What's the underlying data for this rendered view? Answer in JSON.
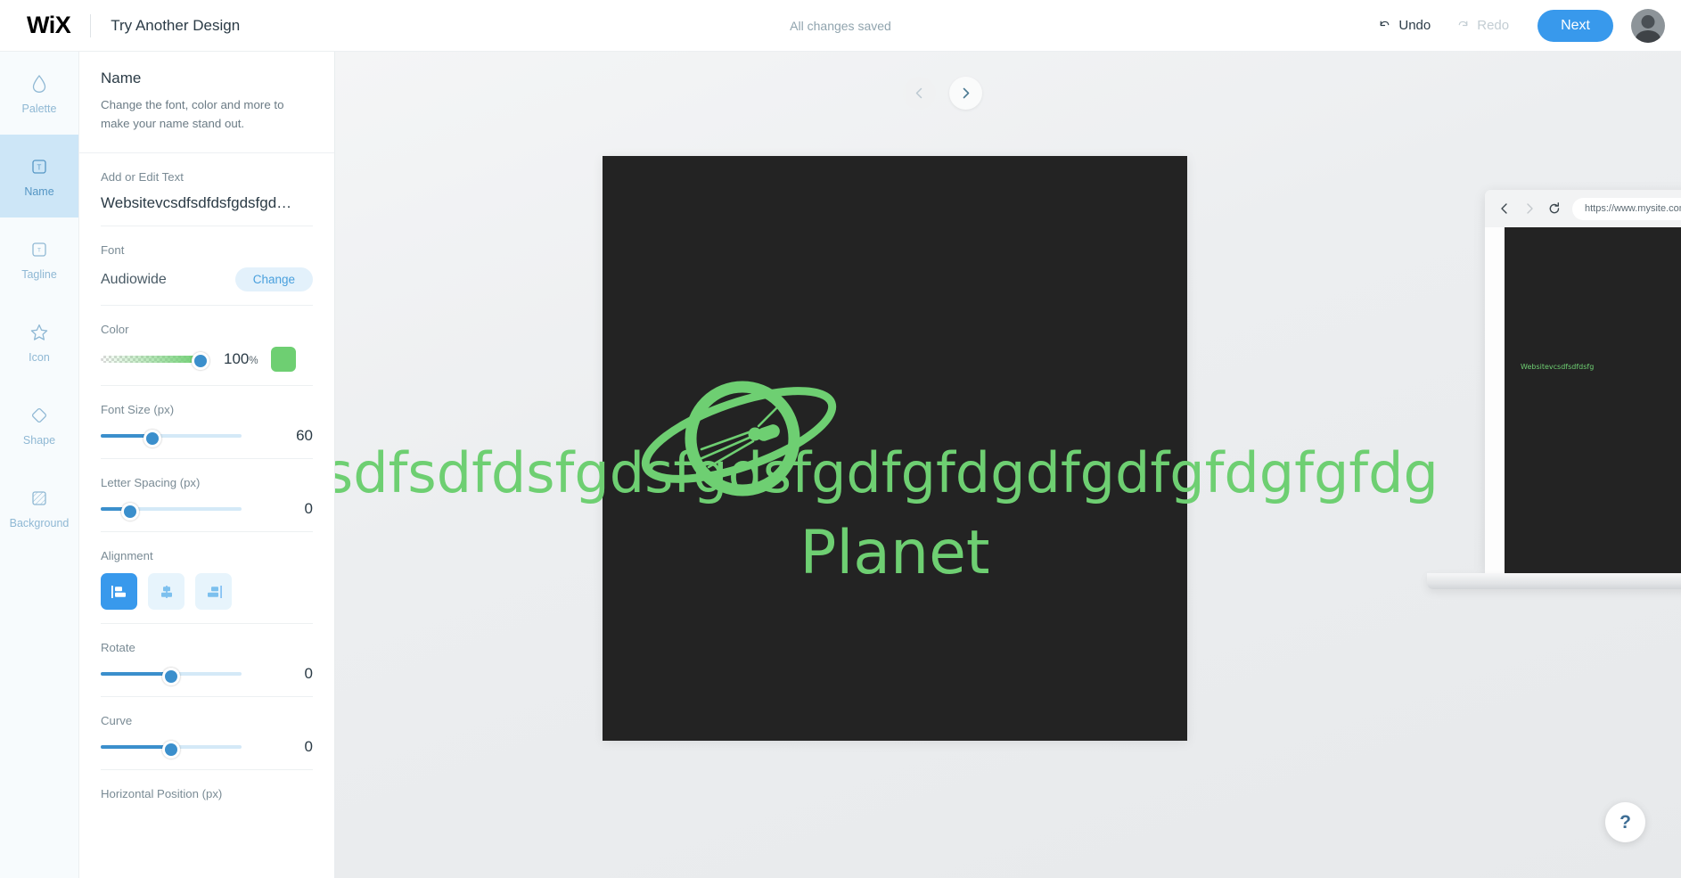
{
  "topbar": {
    "brand": "WiX",
    "try_another_design": "Try Another Design",
    "save_status": "All changes saved",
    "undo_label": "Undo",
    "redo_label": "Redo",
    "next_label": "Next",
    "accent_color": "#3899ec"
  },
  "rail": {
    "items": [
      {
        "label": "Palette",
        "icon": "droplet-icon",
        "active": false
      },
      {
        "label": "Name",
        "icon": "text-box-icon",
        "active": true
      },
      {
        "label": "Tagline",
        "icon": "text-box-small-icon",
        "active": false
      },
      {
        "label": "Icon",
        "icon": "star-icon",
        "active": false
      },
      {
        "label": "Shape",
        "icon": "diamond-icon",
        "active": false
      },
      {
        "label": "Background",
        "icon": "hatched-square-icon",
        "active": false
      }
    ]
  },
  "panel": {
    "title": "Name",
    "description": "Change the font, color and more to make your name stand out.",
    "text_field": {
      "label": "Add or Edit Text",
      "value": "Websitevcsdfsdfdsfgdsfgd…"
    },
    "font": {
      "label": "Font",
      "value": "Audiowide",
      "change_label": "Change"
    },
    "color": {
      "label": "Color",
      "opacity": "100",
      "percent_symbol": "%",
      "swatch_hex": "#6ECF72",
      "slider_position_pct": 100
    },
    "font_size": {
      "label": "Font Size (px)",
      "value": "60",
      "slider_position_pct": 37
    },
    "letter_spacing": {
      "label": "Letter Spacing (px)",
      "value": "0",
      "slider_position_pct": 21
    },
    "alignment": {
      "label": "Alignment",
      "options": [
        {
          "name": "align-left",
          "selected": true
        },
        {
          "name": "align-center",
          "selected": false
        },
        {
          "name": "align-right",
          "selected": false
        }
      ]
    },
    "rotate": {
      "label": "Rotate",
      "value": "0",
      "slider_position_pct": 50
    },
    "curve": {
      "label": "Curve",
      "value": "0",
      "slider_position_pct": 50
    },
    "horizontal_position": {
      "label": "Horizontal Position (px)"
    }
  },
  "canvas": {
    "prev_label": "‹",
    "next_label": "›",
    "logo": {
      "text_band": "Websitevcsdfsdfdsfgdsfgdsfgdfgfdgdfgdfgfdgfgfdg",
      "word": "Planet",
      "text_color": "#6ECF72",
      "background_color": "#232323"
    },
    "browser": {
      "url": "https://www.mysite.com",
      "mini_logo": "Websitevcsdfsdfdsfg"
    },
    "help_label": "?"
  }
}
